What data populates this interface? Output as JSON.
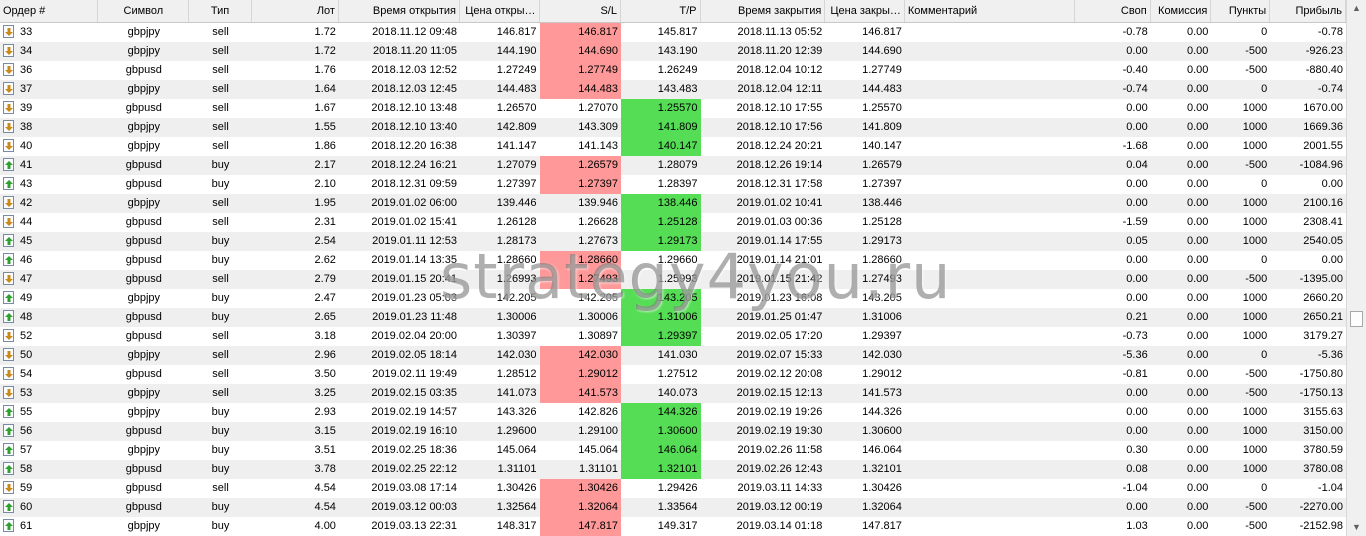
{
  "columns": [
    "Ордер #",
    "Символ",
    "Тип",
    "Лот",
    "Время открытия",
    "Цена откры…",
    "S/L",
    "T/P",
    "Время закрытия",
    "Цена закры…",
    "Комментарий",
    "Своп",
    "Комиссия",
    "Пункты",
    "Прибыль"
  ],
  "watermark": "strategy4you.ru",
  "colors": {
    "sl_hit": "#ff9999",
    "tp_hit": "#55dd55",
    "row_alt": "#efefef",
    "header_bg": "#f0f0f0"
  },
  "rows": [
    {
      "order": "33",
      "symbol": "gbpjpy",
      "type": "sell",
      "lot": "1.72",
      "open_time": "2018.11.12 09:48",
      "open_price": "146.817",
      "sl": "146.817",
      "tp": "145.817",
      "close_time": "2018.11.13 05:52",
      "close_price": "146.817",
      "comment": "",
      "swap": "-0.78",
      "commission": "0.00",
      "points": "0",
      "profit": "-0.78",
      "hit": "sl"
    },
    {
      "order": "34",
      "symbol": "gbpjpy",
      "type": "sell",
      "lot": "1.72",
      "open_time": "2018.11.20 11:05",
      "open_price": "144.190",
      "sl": "144.690",
      "tp": "143.190",
      "close_time": "2018.11.20 12:39",
      "close_price": "144.690",
      "comment": "",
      "swap": "0.00",
      "commission": "0.00",
      "points": "-500",
      "profit": "-926.23",
      "hit": "sl"
    },
    {
      "order": "36",
      "symbol": "gbpusd",
      "type": "sell",
      "lot": "1.76",
      "open_time": "2018.12.03 12:52",
      "open_price": "1.27249",
      "sl": "1.27749",
      "tp": "1.26249",
      "close_time": "2018.12.04 10:12",
      "close_price": "1.27749",
      "comment": "",
      "swap": "-0.40",
      "commission": "0.00",
      "points": "-500",
      "profit": "-880.40",
      "hit": "sl"
    },
    {
      "order": "37",
      "symbol": "gbpjpy",
      "type": "sell",
      "lot": "1.64",
      "open_time": "2018.12.03 12:45",
      "open_price": "144.483",
      "sl": "144.483",
      "tp": "143.483",
      "close_time": "2018.12.04 12:11",
      "close_price": "144.483",
      "comment": "",
      "swap": "-0.74",
      "commission": "0.00",
      "points": "0",
      "profit": "-0.74",
      "hit": "sl"
    },
    {
      "order": "39",
      "symbol": "gbpusd",
      "type": "sell",
      "lot": "1.67",
      "open_time": "2018.12.10 13:48",
      "open_price": "1.26570",
      "sl": "1.27070",
      "tp": "1.25570",
      "close_time": "2018.12.10 17:55",
      "close_price": "1.25570",
      "comment": "",
      "swap": "0.00",
      "commission": "0.00",
      "points": "1000",
      "profit": "1670.00",
      "hit": "tp"
    },
    {
      "order": "38",
      "symbol": "gbpjpy",
      "type": "sell",
      "lot": "1.55",
      "open_time": "2018.12.10 13:40",
      "open_price": "142.809",
      "sl": "143.309",
      "tp": "141.809",
      "close_time": "2018.12.10 17:56",
      "close_price": "141.809",
      "comment": "",
      "swap": "0.00",
      "commission": "0.00",
      "points": "1000",
      "profit": "1669.36",
      "hit": "tp"
    },
    {
      "order": "40",
      "symbol": "gbpjpy",
      "type": "sell",
      "lot": "1.86",
      "open_time": "2018.12.20 16:38",
      "open_price": "141.147",
      "sl": "141.143",
      "tp": "140.147",
      "close_time": "2018.12.24 20:21",
      "close_price": "140.147",
      "comment": "",
      "swap": "-1.68",
      "commission": "0.00",
      "points": "1000",
      "profit": "2001.55",
      "hit": "tp"
    },
    {
      "order": "41",
      "symbol": "gbpusd",
      "type": "buy",
      "lot": "2.17",
      "open_time": "2018.12.24 16:21",
      "open_price": "1.27079",
      "sl": "1.26579",
      "tp": "1.28079",
      "close_time": "2018.12.26 19:14",
      "close_price": "1.26579",
      "comment": "",
      "swap": "0.04",
      "commission": "0.00",
      "points": "-500",
      "profit": "-1084.96",
      "hit": "sl"
    },
    {
      "order": "43",
      "symbol": "gbpusd",
      "type": "buy",
      "lot": "2.10",
      "open_time": "2018.12.31 09:59",
      "open_price": "1.27397",
      "sl": "1.27397",
      "tp": "1.28397",
      "close_time": "2018.12.31 17:58",
      "close_price": "1.27397",
      "comment": "",
      "swap": "0.00",
      "commission": "0.00",
      "points": "0",
      "profit": "0.00",
      "hit": "sl"
    },
    {
      "order": "42",
      "symbol": "gbpjpy",
      "type": "sell",
      "lot": "1.95",
      "open_time": "2019.01.02 06:00",
      "open_price": "139.446",
      "sl": "139.946",
      "tp": "138.446",
      "close_time": "2019.01.02 10:41",
      "close_price": "138.446",
      "comment": "",
      "swap": "0.00",
      "commission": "0.00",
      "points": "1000",
      "profit": "2100.16",
      "hit": "tp"
    },
    {
      "order": "44",
      "symbol": "gbpusd",
      "type": "sell",
      "lot": "2.31",
      "open_time": "2019.01.02 15:41",
      "open_price": "1.26128",
      "sl": "1.26628",
      "tp": "1.25128",
      "close_time": "2019.01.03 00:36",
      "close_price": "1.25128",
      "comment": "",
      "swap": "-1.59",
      "commission": "0.00",
      "points": "1000",
      "profit": "2308.41",
      "hit": "tp"
    },
    {
      "order": "45",
      "symbol": "gbpusd",
      "type": "buy",
      "lot": "2.54",
      "open_time": "2019.01.11 12:53",
      "open_price": "1.28173",
      "sl": "1.27673",
      "tp": "1.29173",
      "close_time": "2019.01.14 17:55",
      "close_price": "1.29173",
      "comment": "",
      "swap": "0.05",
      "commission": "0.00",
      "points": "1000",
      "profit": "2540.05",
      "hit": "tp"
    },
    {
      "order": "46",
      "symbol": "gbpusd",
      "type": "buy",
      "lot": "2.62",
      "open_time": "2019.01.14 13:35",
      "open_price": "1.28660",
      "sl": "1.28660",
      "tp": "1.29660",
      "close_time": "2019.01.14 21:01",
      "close_price": "1.28660",
      "comment": "",
      "swap": "0.00",
      "commission": "0.00",
      "points": "0",
      "profit": "0.00",
      "hit": "sl"
    },
    {
      "order": "47",
      "symbol": "gbpusd",
      "type": "sell",
      "lot": "2.79",
      "open_time": "2019.01.15 20:41",
      "open_price": "1.26993",
      "sl": "1.27493",
      "tp": "1.25993",
      "close_time": "2019.01.15 21:42",
      "close_price": "1.27493",
      "comment": "",
      "swap": "0.00",
      "commission": "0.00",
      "points": "-500",
      "profit": "-1395.00",
      "hit": "sl"
    },
    {
      "order": "49",
      "symbol": "gbpjpy",
      "type": "buy",
      "lot": "2.47",
      "open_time": "2019.01.23 05:03",
      "open_price": "142.205",
      "sl": "142.205",
      "tp": "143.205",
      "close_time": "2019.01.23 16:08",
      "close_price": "143.205",
      "comment": "",
      "swap": "0.00",
      "commission": "0.00",
      "points": "1000",
      "profit": "2660.20",
      "hit": "tp"
    },
    {
      "order": "48",
      "symbol": "gbpusd",
      "type": "buy",
      "lot": "2.65",
      "open_time": "2019.01.23 11:48",
      "open_price": "1.30006",
      "sl": "1.30006",
      "tp": "1.31006",
      "close_time": "2019.01.25 01:47",
      "close_price": "1.31006",
      "comment": "",
      "swap": "0.21",
      "commission": "0.00",
      "points": "1000",
      "profit": "2650.21",
      "hit": "tp"
    },
    {
      "order": "52",
      "symbol": "gbpusd",
      "type": "sell",
      "lot": "3.18",
      "open_time": "2019.02.04 20:00",
      "open_price": "1.30397",
      "sl": "1.30897",
      "tp": "1.29397",
      "close_time": "2019.02.05 17:20",
      "close_price": "1.29397",
      "comment": "",
      "swap": "-0.73",
      "commission": "0.00",
      "points": "1000",
      "profit": "3179.27",
      "hit": "tp"
    },
    {
      "order": "50",
      "symbol": "gbpjpy",
      "type": "sell",
      "lot": "2.96",
      "open_time": "2019.02.05 18:14",
      "open_price": "142.030",
      "sl": "142.030",
      "tp": "141.030",
      "close_time": "2019.02.07 15:33",
      "close_price": "142.030",
      "comment": "",
      "swap": "-5.36",
      "commission": "0.00",
      "points": "0",
      "profit": "-5.36",
      "hit": "sl"
    },
    {
      "order": "54",
      "symbol": "gbpusd",
      "type": "sell",
      "lot": "3.50",
      "open_time": "2019.02.11 19:49",
      "open_price": "1.28512",
      "sl": "1.29012",
      "tp": "1.27512",
      "close_time": "2019.02.12 20:08",
      "close_price": "1.29012",
      "comment": "",
      "swap": "-0.81",
      "commission": "0.00",
      "points": "-500",
      "profit": "-1750.80",
      "hit": "sl"
    },
    {
      "order": "53",
      "symbol": "gbpjpy",
      "type": "sell",
      "lot": "3.25",
      "open_time": "2019.02.15 03:35",
      "open_price": "141.073",
      "sl": "141.573",
      "tp": "140.073",
      "close_time": "2019.02.15 12:13",
      "close_price": "141.573",
      "comment": "",
      "swap": "0.00",
      "commission": "0.00",
      "points": "-500",
      "profit": "-1750.13",
      "hit": "sl"
    },
    {
      "order": "55",
      "symbol": "gbpjpy",
      "type": "buy",
      "lot": "2.93",
      "open_time": "2019.02.19 14:57",
      "open_price": "143.326",
      "sl": "142.826",
      "tp": "144.326",
      "close_time": "2019.02.19 19:26",
      "close_price": "144.326",
      "comment": "",
      "swap": "0.00",
      "commission": "0.00",
      "points": "1000",
      "profit": "3155.63",
      "hit": "tp"
    },
    {
      "order": "56",
      "symbol": "gbpusd",
      "type": "buy",
      "lot": "3.15",
      "open_time": "2019.02.19 16:10",
      "open_price": "1.29600",
      "sl": "1.29100",
      "tp": "1.30600",
      "close_time": "2019.02.19 19:30",
      "close_price": "1.30600",
      "comment": "",
      "swap": "0.00",
      "commission": "0.00",
      "points": "1000",
      "profit": "3150.00",
      "hit": "tp"
    },
    {
      "order": "57",
      "symbol": "gbpjpy",
      "type": "buy",
      "lot": "3.51",
      "open_time": "2019.02.25 18:36",
      "open_price": "145.064",
      "sl": "145.064",
      "tp": "146.064",
      "close_time": "2019.02.26 11:58",
      "close_price": "146.064",
      "comment": "",
      "swap": "0.30",
      "commission": "0.00",
      "points": "1000",
      "profit": "3780.59",
      "hit": "tp"
    },
    {
      "order": "58",
      "symbol": "gbpusd",
      "type": "buy",
      "lot": "3.78",
      "open_time": "2019.02.25 22:12",
      "open_price": "1.31101",
      "sl": "1.31101",
      "tp": "1.32101",
      "close_time": "2019.02.26 12:43",
      "close_price": "1.32101",
      "comment": "",
      "swap": "0.08",
      "commission": "0.00",
      "points": "1000",
      "profit": "3780.08",
      "hit": "tp"
    },
    {
      "order": "59",
      "symbol": "gbpusd",
      "type": "sell",
      "lot": "4.54",
      "open_time": "2019.03.08 17:14",
      "open_price": "1.30426",
      "sl": "1.30426",
      "tp": "1.29426",
      "close_time": "2019.03.11 14:33",
      "close_price": "1.30426",
      "comment": "",
      "swap": "-1.04",
      "commission": "0.00",
      "points": "0",
      "profit": "-1.04",
      "hit": "sl"
    },
    {
      "order": "60",
      "symbol": "gbpusd",
      "type": "buy",
      "lot": "4.54",
      "open_time": "2019.03.12 00:03",
      "open_price": "1.32564",
      "sl": "1.32064",
      "tp": "1.33564",
      "close_time": "2019.03.12 00:19",
      "close_price": "1.32064",
      "comment": "",
      "swap": "0.00",
      "commission": "0.00",
      "points": "-500",
      "profit": "-2270.00",
      "hit": "sl"
    },
    {
      "order": "61",
      "symbol": "gbpjpy",
      "type": "buy",
      "lot": "4.00",
      "open_time": "2019.03.13 22:31",
      "open_price": "148.317",
      "sl": "147.817",
      "tp": "149.317",
      "close_time": "2019.03.14 01:18",
      "close_price": "147.817",
      "comment": "",
      "swap": "1.03",
      "commission": "0.00",
      "points": "-500",
      "profit": "-2152.98",
      "hit": "sl"
    }
  ]
}
